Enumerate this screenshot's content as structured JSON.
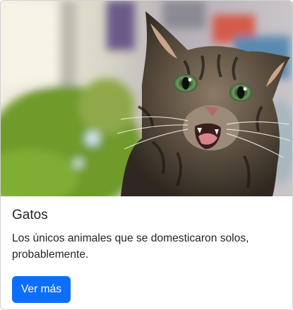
{
  "card": {
    "image_alt": "gato",
    "title": "Gatos",
    "text": "Los únicos animales que se domesticaron solos, probablemente.",
    "button_label": "Ver más"
  },
  "colors": {
    "button_bg": "#0d6efd",
    "button_text": "#ffffff",
    "text": "#212529"
  }
}
